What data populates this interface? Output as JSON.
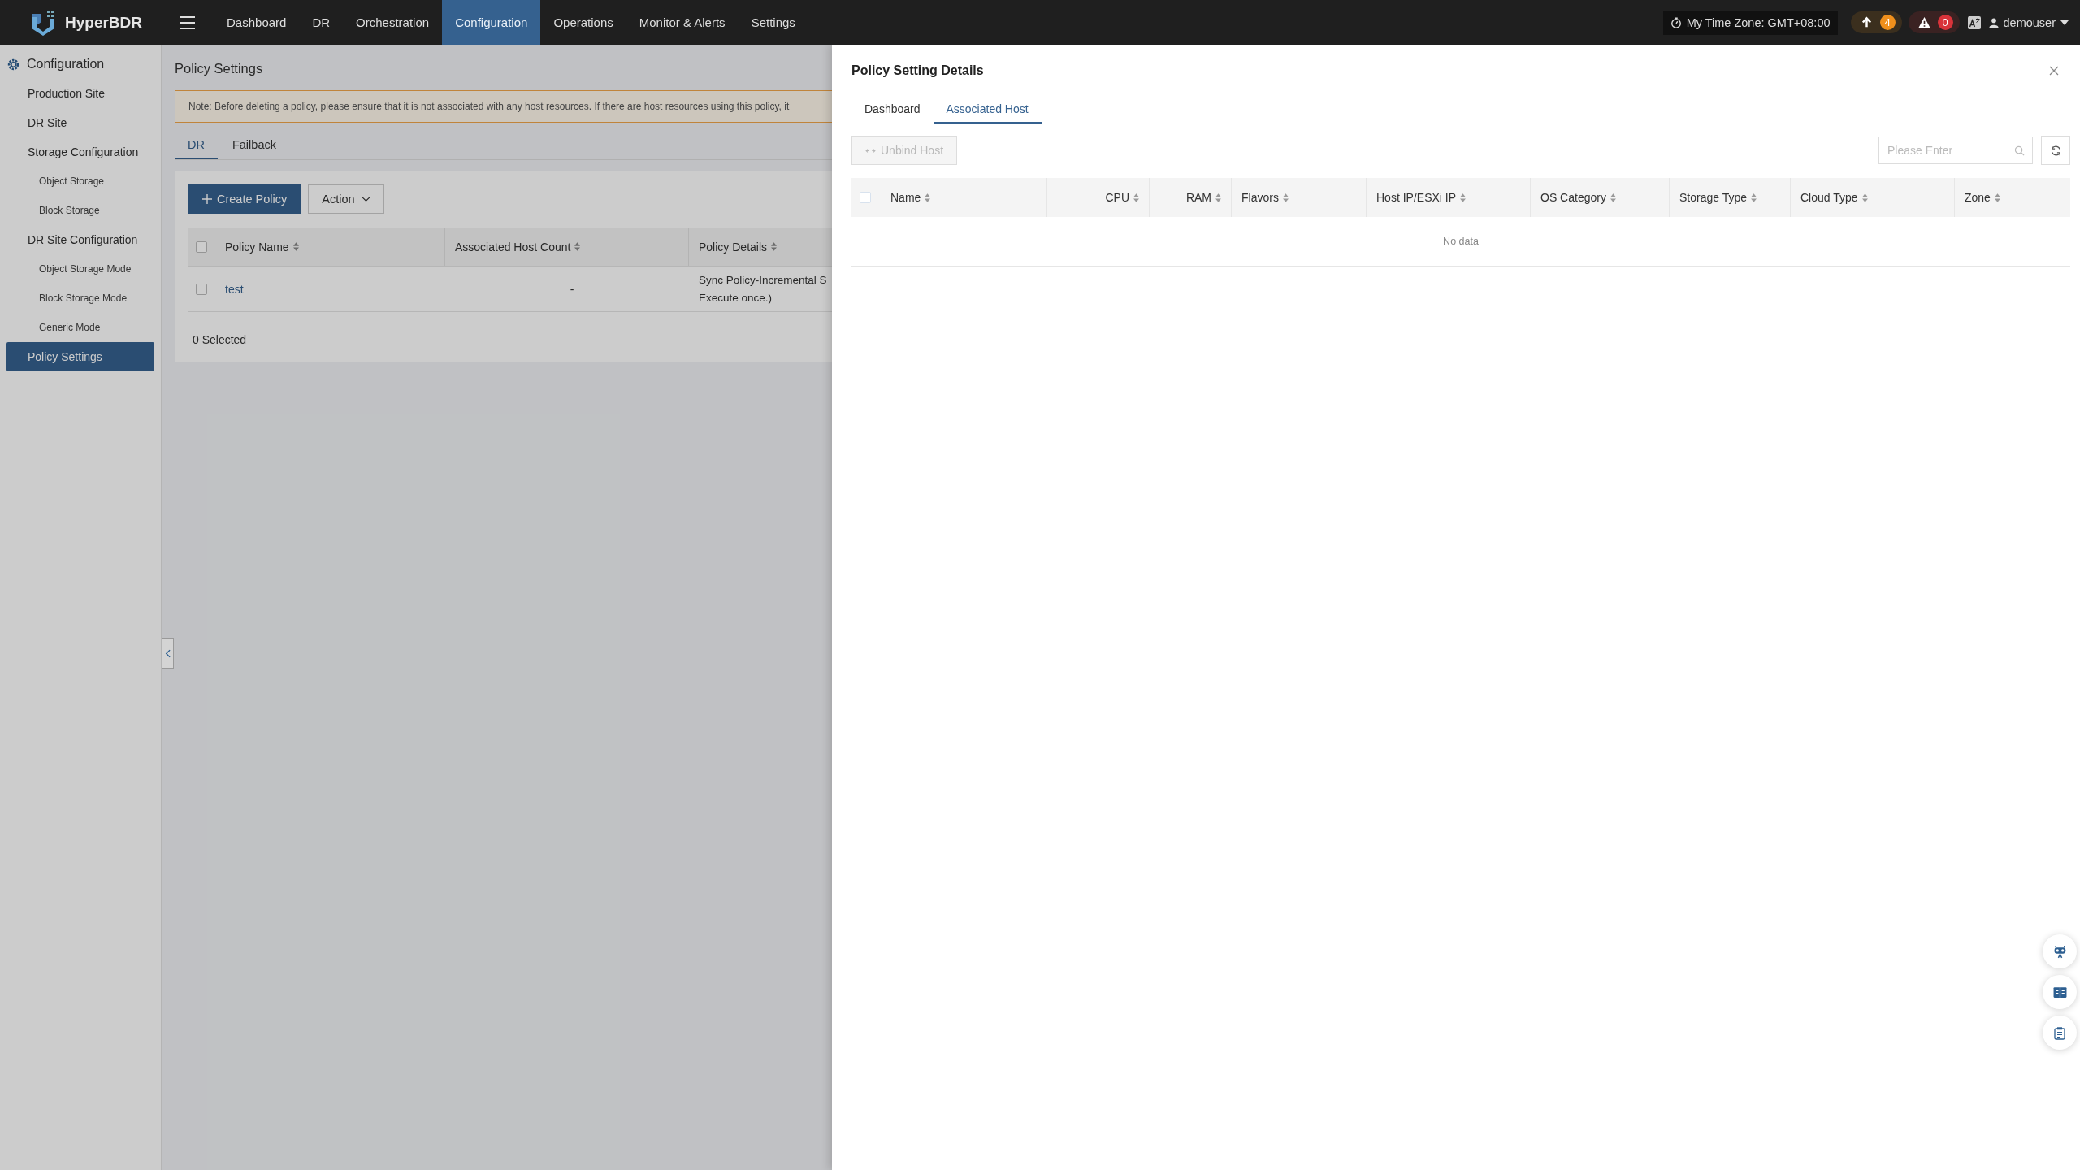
{
  "app": {
    "brand": "HyperBDR"
  },
  "nav": [
    {
      "label": "Dashboard",
      "selected": false
    },
    {
      "label": "DR",
      "selected": false
    },
    {
      "label": "Orchestration",
      "selected": false
    },
    {
      "label": "Configuration",
      "selected": true
    },
    {
      "label": "Operations",
      "selected": false
    },
    {
      "label": "Monitor & Alerts",
      "selected": false
    },
    {
      "label": "Settings",
      "selected": false
    }
  ],
  "header": {
    "timezone": "My Time Zone: GMT+08:00",
    "uploads": "4",
    "alerts": "0",
    "user": "demouser"
  },
  "sidebar": {
    "title": "Configuration",
    "items": [
      {
        "label": "Production Site",
        "selected": false
      },
      {
        "label": "DR Site",
        "selected": false
      },
      {
        "label": "Storage Configuration",
        "selected": false,
        "children": [
          {
            "label": "Object Storage",
            "selected": false
          },
          {
            "label": "Block Storage",
            "selected": false
          }
        ]
      },
      {
        "label": "DR Site Configuration",
        "selected": false,
        "children": [
          {
            "label": "Object Storage Mode",
            "selected": false
          },
          {
            "label": "Block Storage Mode",
            "selected": false
          },
          {
            "label": "Generic Mode",
            "selected": false
          }
        ]
      },
      {
        "label": "Policy Settings",
        "selected": true
      }
    ]
  },
  "page": {
    "title": "Policy Settings",
    "note": "Note: Before deleting a policy, please ensure that it is not associated with any host resources. If there are host resources using this policy, it",
    "tabs": [
      {
        "label": "DR",
        "selected": true
      },
      {
        "label": "Failback",
        "selected": false
      }
    ],
    "create_button": "Create Policy",
    "action_button": "Action",
    "table": {
      "select_all_checked": false,
      "columns": [
        "Policy Name",
        "Associated Host Count",
        "Policy Details"
      ],
      "rows": [
        {
          "checked": false,
          "name": "test",
          "host_count": "-",
          "details": [
            "Sync Policy-Incremental S",
            "Execute once.)"
          ]
        }
      ]
    },
    "selection": "0 Selected"
  },
  "drawer": {
    "title": "Policy Setting Details",
    "tabs": [
      {
        "label": "Dashboard",
        "selected": false
      },
      {
        "label": "Associated Host",
        "selected": true
      }
    ],
    "unbind_button": {
      "label": "Unbind Host",
      "disabled": true
    },
    "search": {
      "placeholder": "Please Enter"
    },
    "table": {
      "select_all_checked": false,
      "columns": [
        {
          "label": "Name",
          "kind": "text"
        },
        {
          "label": "CPU",
          "kind": "number"
        },
        {
          "label": "RAM",
          "kind": "number"
        },
        {
          "label": "Flavors",
          "kind": "text"
        },
        {
          "label": "Host IP/ESXi IP",
          "kind": "text"
        },
        {
          "label": "OS Category",
          "kind": "text"
        },
        {
          "label": "Storage Type",
          "kind": "text"
        },
        {
          "label": "Cloud Type",
          "kind": "text"
        },
        {
          "label": "Zone",
          "kind": "text"
        }
      ],
      "empty": "No data"
    }
  }
}
